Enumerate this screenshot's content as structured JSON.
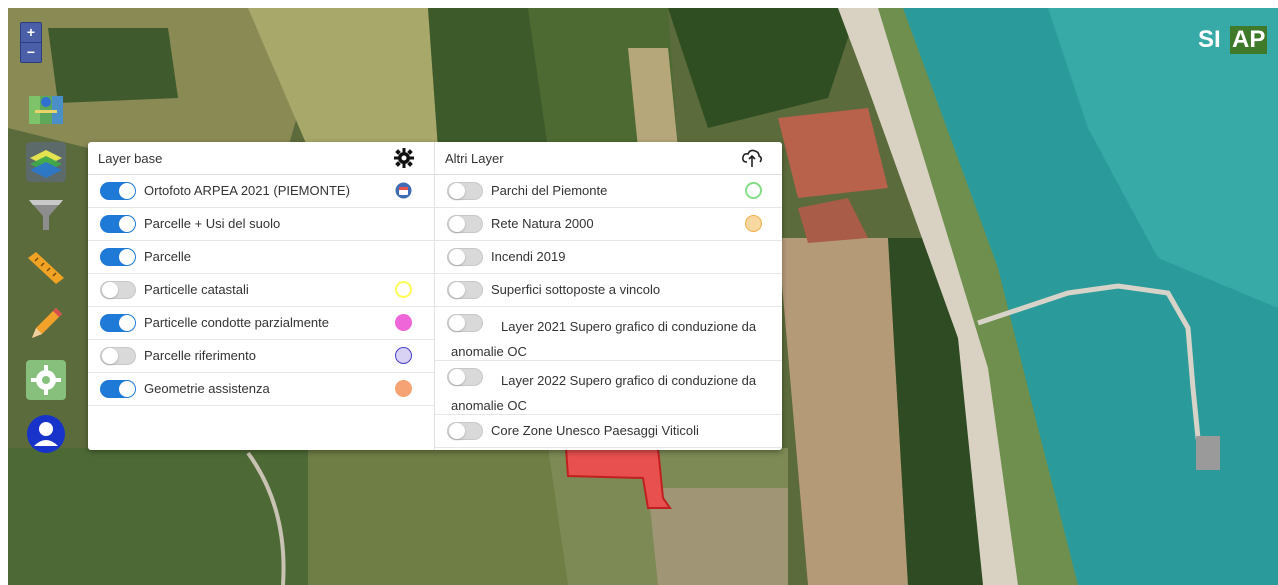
{
  "map": {
    "zoom_in": "+",
    "zoom_out": "−",
    "logo": {
      "part1": "SI",
      "part2": "AP"
    }
  },
  "toolbar": {
    "items": [
      {
        "name": "map-icon"
      },
      {
        "name": "layers-icon"
      },
      {
        "name": "filter-icon"
      },
      {
        "name": "ruler-icon"
      },
      {
        "name": "pencil-icon"
      },
      {
        "name": "gear-icon"
      },
      {
        "name": "user-icon"
      }
    ]
  },
  "panel": {
    "base": {
      "title": "Layer base",
      "icon": "gear-icon",
      "items": [
        {
          "label": "Ortofoto ARPEA 2021 (PIEMONTE)",
          "on": true,
          "icon": "calendar-icon"
        },
        {
          "label": "Parcelle + Usi del suolo",
          "on": true
        },
        {
          "label": "Parcelle",
          "on": true
        },
        {
          "label": "Particelle catastali",
          "on": false,
          "color": "#ffff55",
          "style": "outline"
        },
        {
          "label": "Particelle condotte parzialmente",
          "on": true,
          "color": "#ee66d8",
          "style": "fill"
        },
        {
          "label": "Parcelle riferimento",
          "on": false,
          "color": "#d8d2f5",
          "border": "#4a3fc8",
          "style": "fill"
        },
        {
          "label": "Geometrie assistenza",
          "on": true,
          "color": "#f5a374",
          "style": "fill"
        }
      ]
    },
    "other": {
      "title": "Altri Layer",
      "icon": "cloud-upload-icon",
      "items": [
        {
          "label": "Parchi del Piemonte",
          "on": false,
          "color": "#88dd88",
          "style": "outline"
        },
        {
          "label": "Rete Natura 2000",
          "on": false,
          "color": "#f9d7a0",
          "border": "#f0b050",
          "style": "fill"
        },
        {
          "label": "Incendi 2019",
          "on": false
        },
        {
          "label": "Superfici sottoposte a vincolo",
          "on": false
        },
        {
          "label": "Layer 2021 Supero grafico di conduzione da anomalie OC",
          "on": false
        },
        {
          "label": "Layer 2022 Supero grafico di conduzione da anomalie OC",
          "on": false
        },
        {
          "label": "Core Zone Unesco Paesaggi Viticoli",
          "on": false
        }
      ]
    }
  },
  "colors": {
    "toggle_on": "#1f7ad7",
    "toggle_off": "#d9d9d9",
    "zoom": "#4a5fa8",
    "highlight_parcel": "#e8504f"
  }
}
